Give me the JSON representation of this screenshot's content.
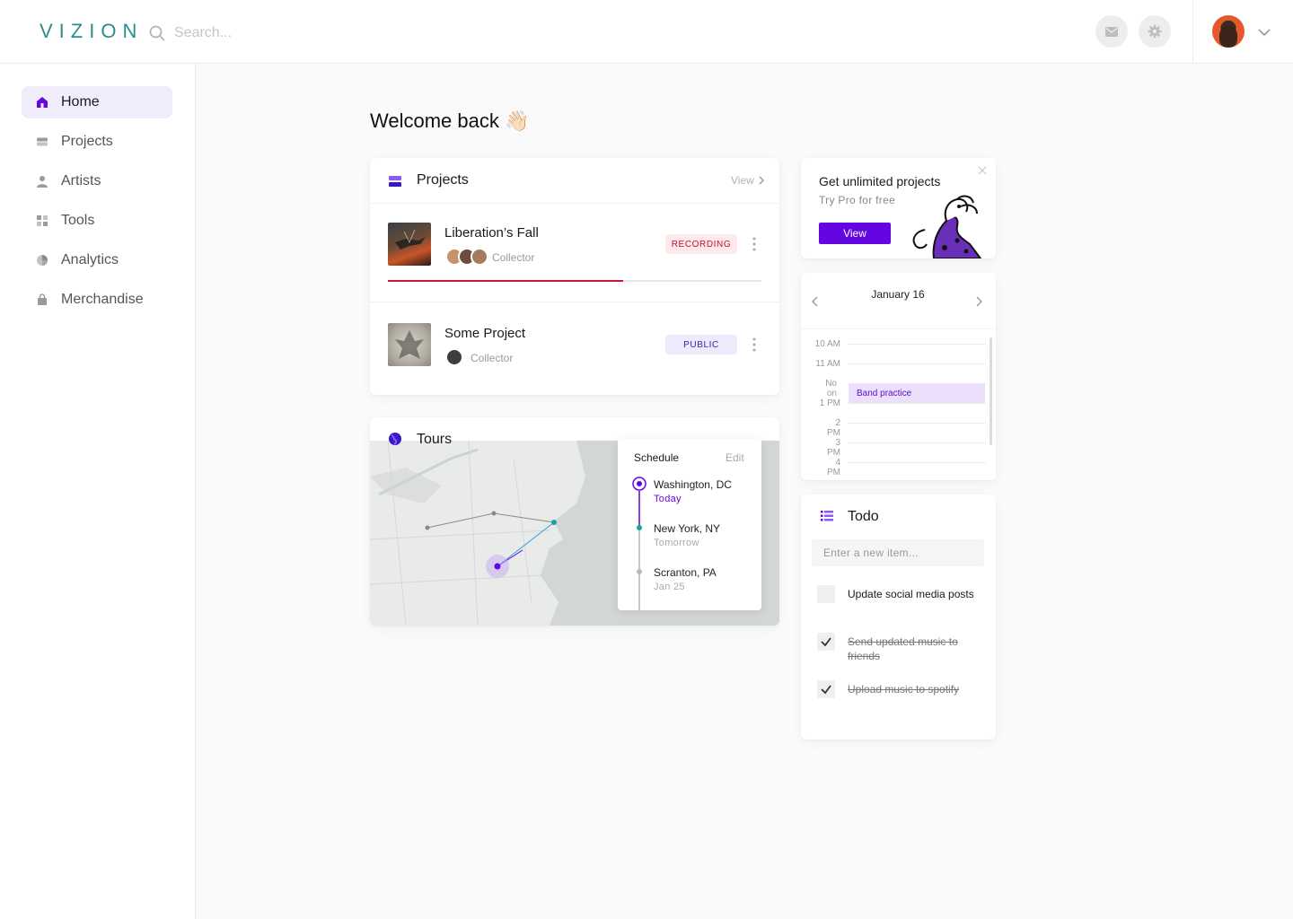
{
  "header": {
    "logo": "VIZION",
    "search_placeholder": "Search..."
  },
  "sidebar": {
    "items": [
      {
        "label": "Home",
        "icon": "home-icon",
        "active": true
      },
      {
        "label": "Projects",
        "icon": "projects-icon"
      },
      {
        "label": "Artists",
        "icon": "person-icon"
      },
      {
        "label": "Tools",
        "icon": "grid-icon"
      },
      {
        "label": "Analytics",
        "icon": "pie-icon"
      },
      {
        "label": "Merchandise",
        "icon": "bag-icon"
      }
    ]
  },
  "main": {
    "welcome": "Welcome back 👋🏻"
  },
  "projects": {
    "title": "Projects",
    "view_label": "View",
    "items": [
      {
        "name": "Liberation’s Fall",
        "role": "Collector",
        "status": "RECORDING",
        "progress": 0.63
      },
      {
        "name": "Some Project",
        "role": "Collector",
        "status": "PUBLIC"
      }
    ]
  },
  "tours": {
    "title": "Tours",
    "schedule": {
      "title": "Schedule",
      "edit_label": "Edit",
      "stops": [
        {
          "city": "Washington, DC",
          "date": "Today"
        },
        {
          "city": "New York, NY",
          "date": "Tomorrow"
        },
        {
          "city": "Scranton, PA",
          "date": "Jan 25"
        }
      ]
    }
  },
  "promo": {
    "title": "Get unlimited projects",
    "subtitle": "Try Pro for free",
    "button": "View"
  },
  "calendar": {
    "month_label": "January 16",
    "hours": [
      "10 AM",
      "11 AM",
      "Noon",
      "1 PM",
      "2 PM",
      "3 PM",
      "4 PM"
    ],
    "event": "Band practice"
  },
  "todo": {
    "title": "Todo",
    "input_placeholder": "Enter a new item...",
    "items": [
      {
        "text": "Update social media posts",
        "done": false
      },
      {
        "text": "Send updated music to friends",
        "done": true
      },
      {
        "text": "Upload music to spotify",
        "done": true
      }
    ]
  },
  "colors": {
    "accent": "#6406e0",
    "recording": "#d0142c",
    "teal": "#1aa39a"
  }
}
